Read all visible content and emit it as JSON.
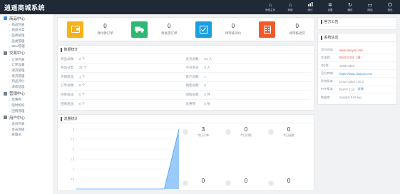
{
  "header": {
    "logo": "逍遥商城系统",
    "nav": [
      {
        "icon": "home-icon",
        "glyph": "⌂",
        "label": "系统主页"
      },
      {
        "icon": "store-icon",
        "glyph": "⌂",
        "label": "商城"
      },
      {
        "icon": "stats-icon",
        "glyph": "▮",
        "label": "统计"
      },
      {
        "icon": "settings-icon",
        "glyph": "✲",
        "label": "设置"
      },
      {
        "icon": "refresh-icon",
        "glyph": "↻",
        "label": "缓存"
      },
      {
        "icon": "monitor-icon",
        "glyph": "▭",
        "label": "网站"
      },
      {
        "icon": "exit-icon",
        "glyph": "⏻",
        "label": "退出"
      }
    ]
  },
  "sidebar": {
    "sections": [
      {
        "title": "商品中心",
        "items": [
          "商品列表",
          "商品分类",
          "品牌管理",
          "品类管理",
          "SKU管理"
        ]
      },
      {
        "title": "交易中心",
        "items": [
          "订单列表",
          "订单设置",
          "退货管理",
          "发货管理",
          "商品评价",
          "退款处理"
        ]
      },
      {
        "title": "营销中心",
        "items": [
          "优惠券",
          "限时折扣",
          "团购管理"
        ]
      },
      {
        "title": "用户中心",
        "items": [
          "会员列表",
          "会员等级",
          "管理员"
        ]
      }
    ]
  },
  "stats": [
    {
      "icon": "wallet-icon",
      "color": "#f6b21b",
      "value": "0",
      "label": "待付款订单"
    },
    {
      "icon": "truck-icon",
      "color": "#2eb872",
      "value": "0",
      "label": "待发货订单"
    },
    {
      "icon": "check-icon",
      "color": "#1b9fe0",
      "value": "0",
      "label": "待审核评价"
    },
    {
      "icon": "calendar-icon",
      "color": "#f05a2a",
      "value": "0",
      "label": "待审核退货"
    }
  ],
  "data_stats": {
    "title": "数据统计",
    "rows": [
      [
        {
          "k": "商品总数:",
          "v": "2 个"
        },
        {
          "k": "会员总数:",
          "v": "61 人"
        }
      ],
      [
        {
          "k": "商品分类:",
          "v": "31 个"
        },
        {
          "k": "今日会员:",
          "v": "0 人"
        }
      ],
      [
        {
          "k": "热销商品:",
          "v": "1 个"
        },
        {
          "k": "客户总数:",
          "v": "1"
        }
      ],
      [
        {
          "k": "订单总数:",
          "v": "0 个"
        },
        {
          "k": "销售总额:",
          "v": "0"
        }
      ],
      [
        {
          "k": "待审商品:",
          "v": "0 个"
        },
        {
          "k": "团购总数:",
          "v": "0 件"
        }
      ],
      [
        {
          "k": "团购商品:",
          "v": "0 个"
        },
        {
          "k": "优惠券:",
          "v": "0 张"
        }
      ]
    ]
  },
  "order_stats": {
    "title": "流量统计",
    "stats": [
      {
        "value": "3",
        "label": "今日订单"
      },
      {
        "value": "0",
        "label": "今日付款"
      },
      {
        "value": "0",
        "label": "今日退款"
      },
      {
        "value": "0",
        "label": ""
      },
      {
        "value": "0",
        "label": ""
      },
      {
        "value": "0",
        "label": ""
      }
    ]
  },
  "chart_data": {
    "type": "area",
    "title": "",
    "xlabel": "",
    "ylabel": "",
    "yticks": [
      "3",
      "2.5",
      "2",
      "1.5",
      "1",
      "0.5"
    ],
    "x": [
      0,
      1,
      2,
      3,
      4,
      5,
      6,
      7
    ],
    "values": [
      0,
      0,
      0,
      0,
      0,
      0,
      0,
      3
    ],
    "ylim": [
      0,
      3
    ],
    "color": "#4a9ff5"
  },
  "right": {
    "notice_title": "官方公告",
    "sysinfo_title": "系统信息",
    "rows": [
      {
        "k": "官方网站:",
        "v": "www.xiaoyao.com",
        "style": "red"
      },
      {
        "k": "交流群:",
        "v": "584234101（满）",
        "style": "red"
      },
      {
        "k": "QQ群:",
        "v": "103274410",
        "style": ""
      },
      {
        "k": "官方商城:",
        "v": "https://www.xiaoyao.com",
        "style": "blue"
      },
      {
        "k": "系统版本:",
        "v": "Linux nginx/1.10.3",
        "style": ""
      },
      {
        "k": "PHP版本:",
        "v": "PHP/7.2.15",
        "style": "",
        "link": "详情"
      },
      {
        "k": "数据库:",
        "v": "mysql:5.5.62-log",
        "style": ""
      }
    ]
  }
}
